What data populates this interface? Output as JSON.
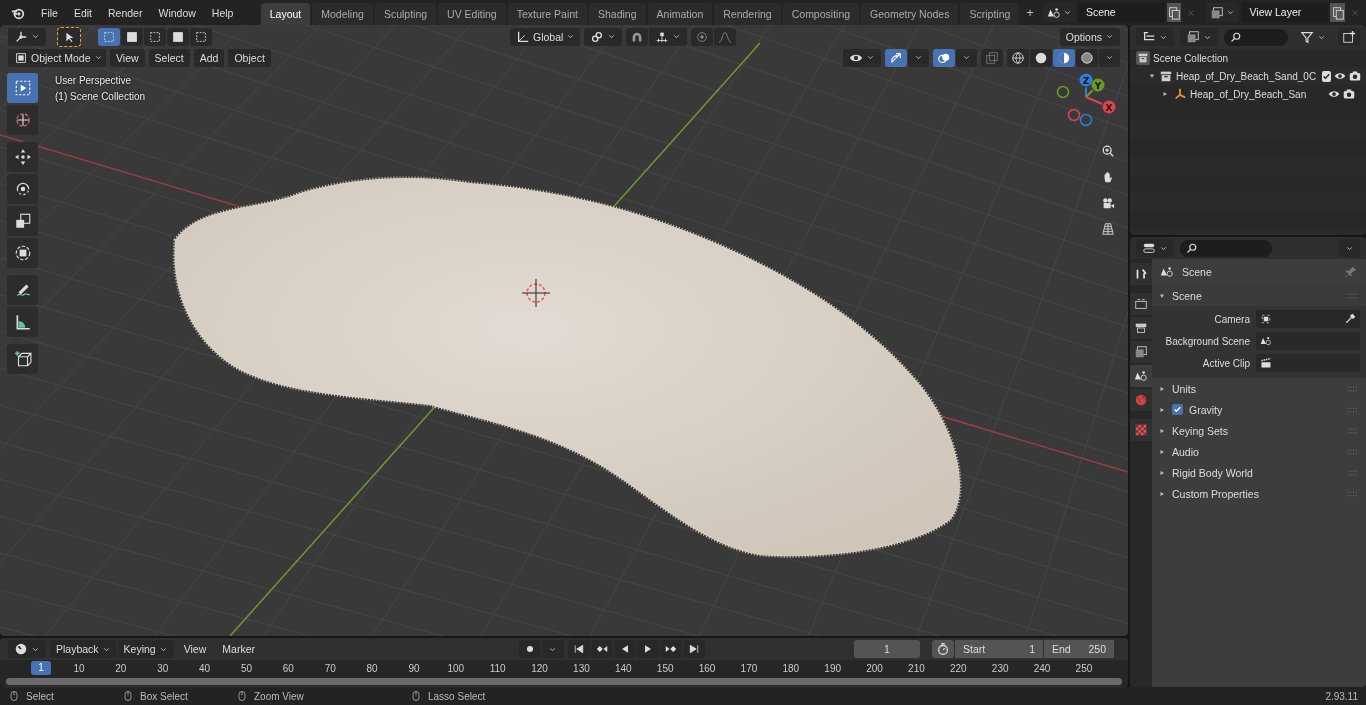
{
  "menu": [
    "File",
    "Edit",
    "Render",
    "Window",
    "Help"
  ],
  "workspace_tabs": [
    {
      "label": "Layout",
      "selected": true
    },
    {
      "label": "Modeling",
      "selected": false
    },
    {
      "label": "Sculpting",
      "selected": false
    },
    {
      "label": "UV Editing",
      "selected": false
    },
    {
      "label": "Texture Paint",
      "selected": false
    },
    {
      "label": "Shading",
      "selected": false
    },
    {
      "label": "Animation",
      "selected": false
    },
    {
      "label": "Rendering",
      "selected": false
    },
    {
      "label": "Compositing",
      "selected": false
    },
    {
      "label": "Geometry Nodes",
      "selected": false
    },
    {
      "label": "Scripting",
      "selected": false
    }
  ],
  "add_tab_glyph": "+",
  "scene": {
    "value": "Scene"
  },
  "view_layer": {
    "value": "View Layer"
  },
  "tool_settings": {
    "orientation": "Global",
    "options": "Options",
    "select_modes": [
      {
        "selected": true
      },
      {
        "selected": false
      },
      {
        "selected": false
      },
      {
        "selected": false
      },
      {
        "selected": false
      }
    ]
  },
  "viewport_header": {
    "mode": "Object Mode",
    "menus": [
      "View",
      "Select",
      "Add",
      "Object"
    ]
  },
  "viewport": {
    "overlay_lines": [
      "User Perspective",
      "(1) Scene Collection"
    ],
    "gizmo_axes": [
      {
        "label": "Z",
        "color": "#2f7fd8"
      },
      {
        "label": "Y",
        "color": "#6b9a1f"
      },
      {
        "label": "X",
        "color": "#e0404f"
      }
    ]
  },
  "toolbar": [
    {
      "kind": "select",
      "selected": true
    },
    {
      "kind": "cursor",
      "selected": false
    },
    {
      "kind": "move",
      "selected": false
    },
    {
      "kind": "rotate",
      "selected": false
    },
    {
      "kind": "scale",
      "selected": false
    },
    {
      "kind": "transform",
      "selected": false
    },
    {
      "kind": "annotate",
      "selected": false
    },
    {
      "kind": "measure",
      "selected": false
    },
    {
      "kind": "add-cube",
      "selected": false
    }
  ],
  "outliner": {
    "items": [
      {
        "label": "Scene Collection",
        "kind": "scene",
        "children": [
          {
            "label": "Heap_of_Dry_Beach_Sand_0C",
            "kind": "collection",
            "expanded": true,
            "checked": true,
            "children": [
              {
                "label": "Heap_of_Dry_Beach_San",
                "kind": "object",
                "expanded": false
              }
            ]
          }
        ]
      }
    ]
  },
  "properties": {
    "tabs": [
      {
        "kind": "tool",
        "selected": false
      },
      {
        "kind": "render",
        "selected": false
      },
      {
        "kind": "output",
        "selected": false
      },
      {
        "kind": "view-layer",
        "selected": false
      },
      {
        "kind": "scene",
        "selected": true
      },
      {
        "kind": "world",
        "selected": false
      },
      {
        "kind": "texture",
        "selected": false
      }
    ],
    "context": "Scene",
    "panel": {
      "title": "Scene",
      "expanded": true,
      "fields": [
        {
          "label": "Camera",
          "kind": "camera"
        },
        {
          "label": "Background Scene",
          "kind": "scene"
        },
        {
          "label": "Active Clip",
          "kind": "clip"
        }
      ]
    },
    "sections": [
      {
        "label": "Units",
        "expanded": false
      },
      {
        "label": "Gravity",
        "expanded": false,
        "checked": true
      },
      {
        "label": "Keying Sets",
        "expanded": false
      },
      {
        "label": "Audio",
        "expanded": false
      },
      {
        "label": "Rigid Body World",
        "expanded": false
      },
      {
        "label": "Custom Properties",
        "expanded": false
      }
    ]
  },
  "timeline": {
    "menus": [
      "Playback",
      "Keying",
      "View",
      "Marker"
    ],
    "current_frame": "1",
    "start_label": "Start",
    "start": "1",
    "end_label": "End",
    "end": "250",
    "ruler_current": "1",
    "ruler_ticks": [
      "10",
      "20",
      "30",
      "40",
      "50",
      "60",
      "70",
      "80",
      "90",
      "100",
      "110",
      "120",
      "130",
      "140",
      "150",
      "160",
      "170",
      "180",
      "190",
      "200",
      "210",
      "220",
      "230",
      "240",
      "250"
    ]
  },
  "status_bar": {
    "hints": [
      "Select",
      "Box Select",
      "Zoom View",
      "Lasso Select"
    ],
    "version": "2.93.11"
  }
}
